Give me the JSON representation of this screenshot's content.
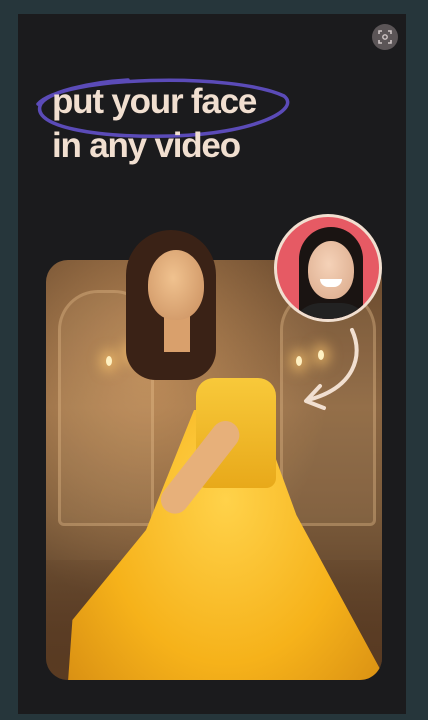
{
  "headline": {
    "line1": "put your face",
    "line2": "in any video"
  },
  "icons": {
    "scan": "face-scan-icon",
    "arrow": "curved-arrow-icon"
  },
  "colors": {
    "background": "#26363b",
    "frame": "#1b1b1d",
    "headline_text": "#f1dfd0",
    "scribble": "#5b4bb8",
    "avatar_bg": "#e65a64",
    "dress": "#f6b21a"
  }
}
